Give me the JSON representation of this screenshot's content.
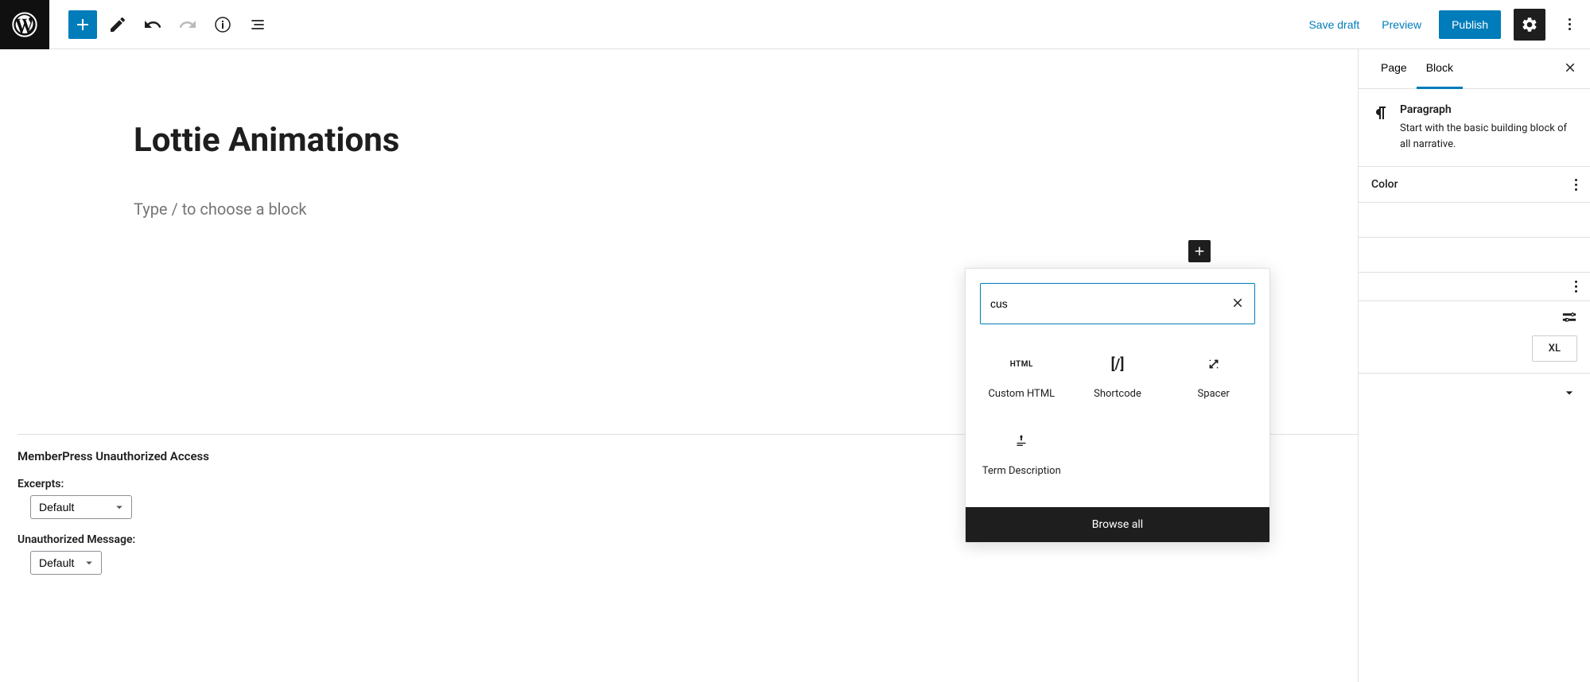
{
  "toolbar": {
    "save_draft": "Save draft",
    "preview": "Preview",
    "publish": "Publish"
  },
  "editor": {
    "title": "Lottie Animations",
    "placeholder": "Type / to choose a block"
  },
  "inserter": {
    "search_value": "cus",
    "results": [
      {
        "label": "Custom HTML",
        "icon": "html"
      },
      {
        "label": "Shortcode",
        "icon": "shortcode"
      },
      {
        "label": "Spacer",
        "icon": "spacer"
      },
      {
        "label": "Term Description",
        "icon": "term"
      }
    ],
    "browse_all": "Browse all"
  },
  "memberpress": {
    "title": "MemberPress Unauthorized Access",
    "excerpts_label": "Excerpts:",
    "excerpts_value": "Default",
    "unauth_label": "Unauthorized Message:",
    "unauth_value": "Default"
  },
  "sidebar": {
    "tabs": {
      "page": "Page",
      "block": "Block"
    },
    "block_name": "Paragraph",
    "block_desc": "Start with the basic building block of all narrative.",
    "panels": {
      "color": "Color"
    },
    "size_xl": "XL"
  }
}
